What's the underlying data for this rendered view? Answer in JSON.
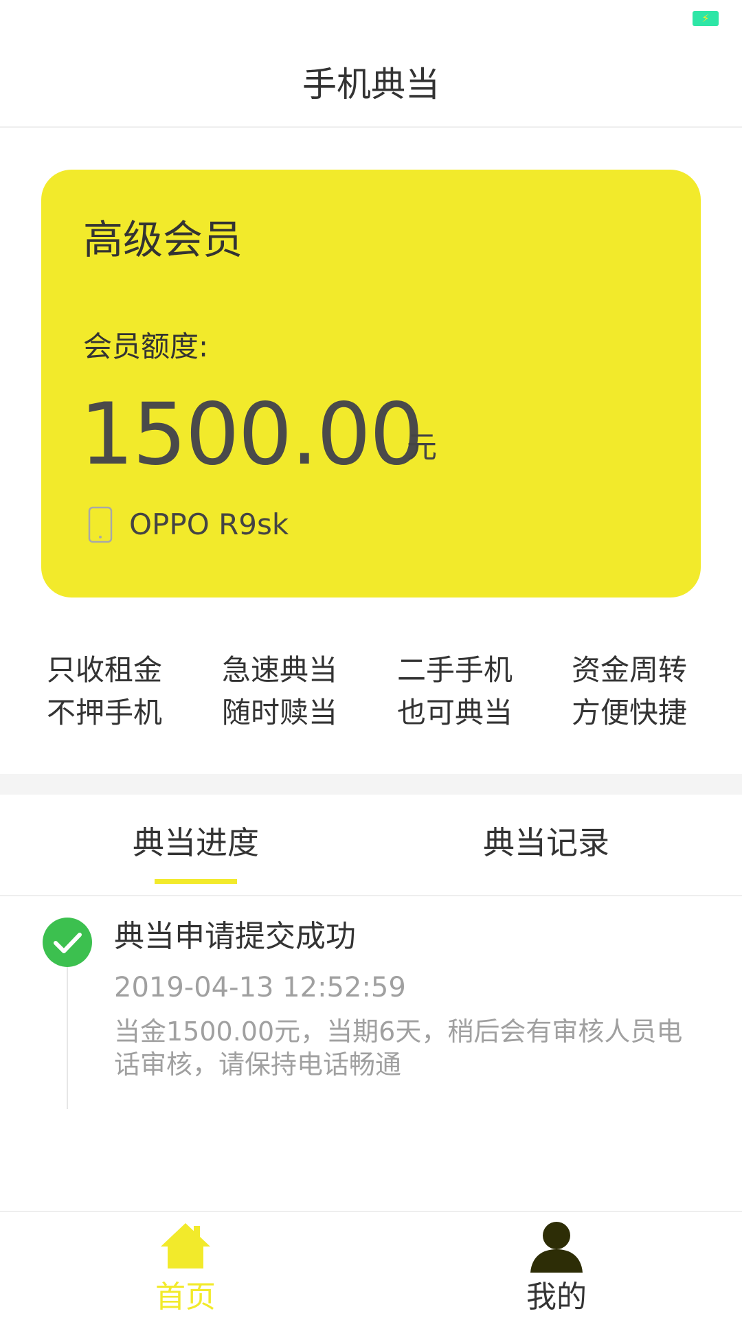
{
  "header": {
    "title": "手机典当"
  },
  "card": {
    "level": "高级会员",
    "quota_label": "会员额度:",
    "amount": "1500.00",
    "unit": "元",
    "device": "OPPO R9sk"
  },
  "features": [
    {
      "line1": "只收租金",
      "line2": "不押手机"
    },
    {
      "line1": "急速典当",
      "line2": "随时赎当"
    },
    {
      "line1": "二手手机",
      "line2": "也可典当"
    },
    {
      "line1": "资金周转",
      "line2": "方便快捷"
    }
  ],
  "tabs": [
    {
      "label": "典当进度",
      "active": true
    },
    {
      "label": "典当记录",
      "active": false
    }
  ],
  "timeline": [
    {
      "title": "典当申请提交成功",
      "time": "2019-04-13 12:52:59",
      "desc": "当金1500.00元，当期6天，稍后会有审核人员电话审核，请保持电话畅通",
      "icon": "check-circle-icon"
    }
  ],
  "bottom_nav": [
    {
      "label": "首页",
      "icon": "home-icon",
      "active": true
    },
    {
      "label": "我的",
      "icon": "user-icon",
      "active": false
    }
  ],
  "colors": {
    "accent": "#f2ea2b",
    "success": "#3cc04f",
    "battery": "#2ee6a6",
    "text": "#333333",
    "muted": "#a0a0a0"
  }
}
